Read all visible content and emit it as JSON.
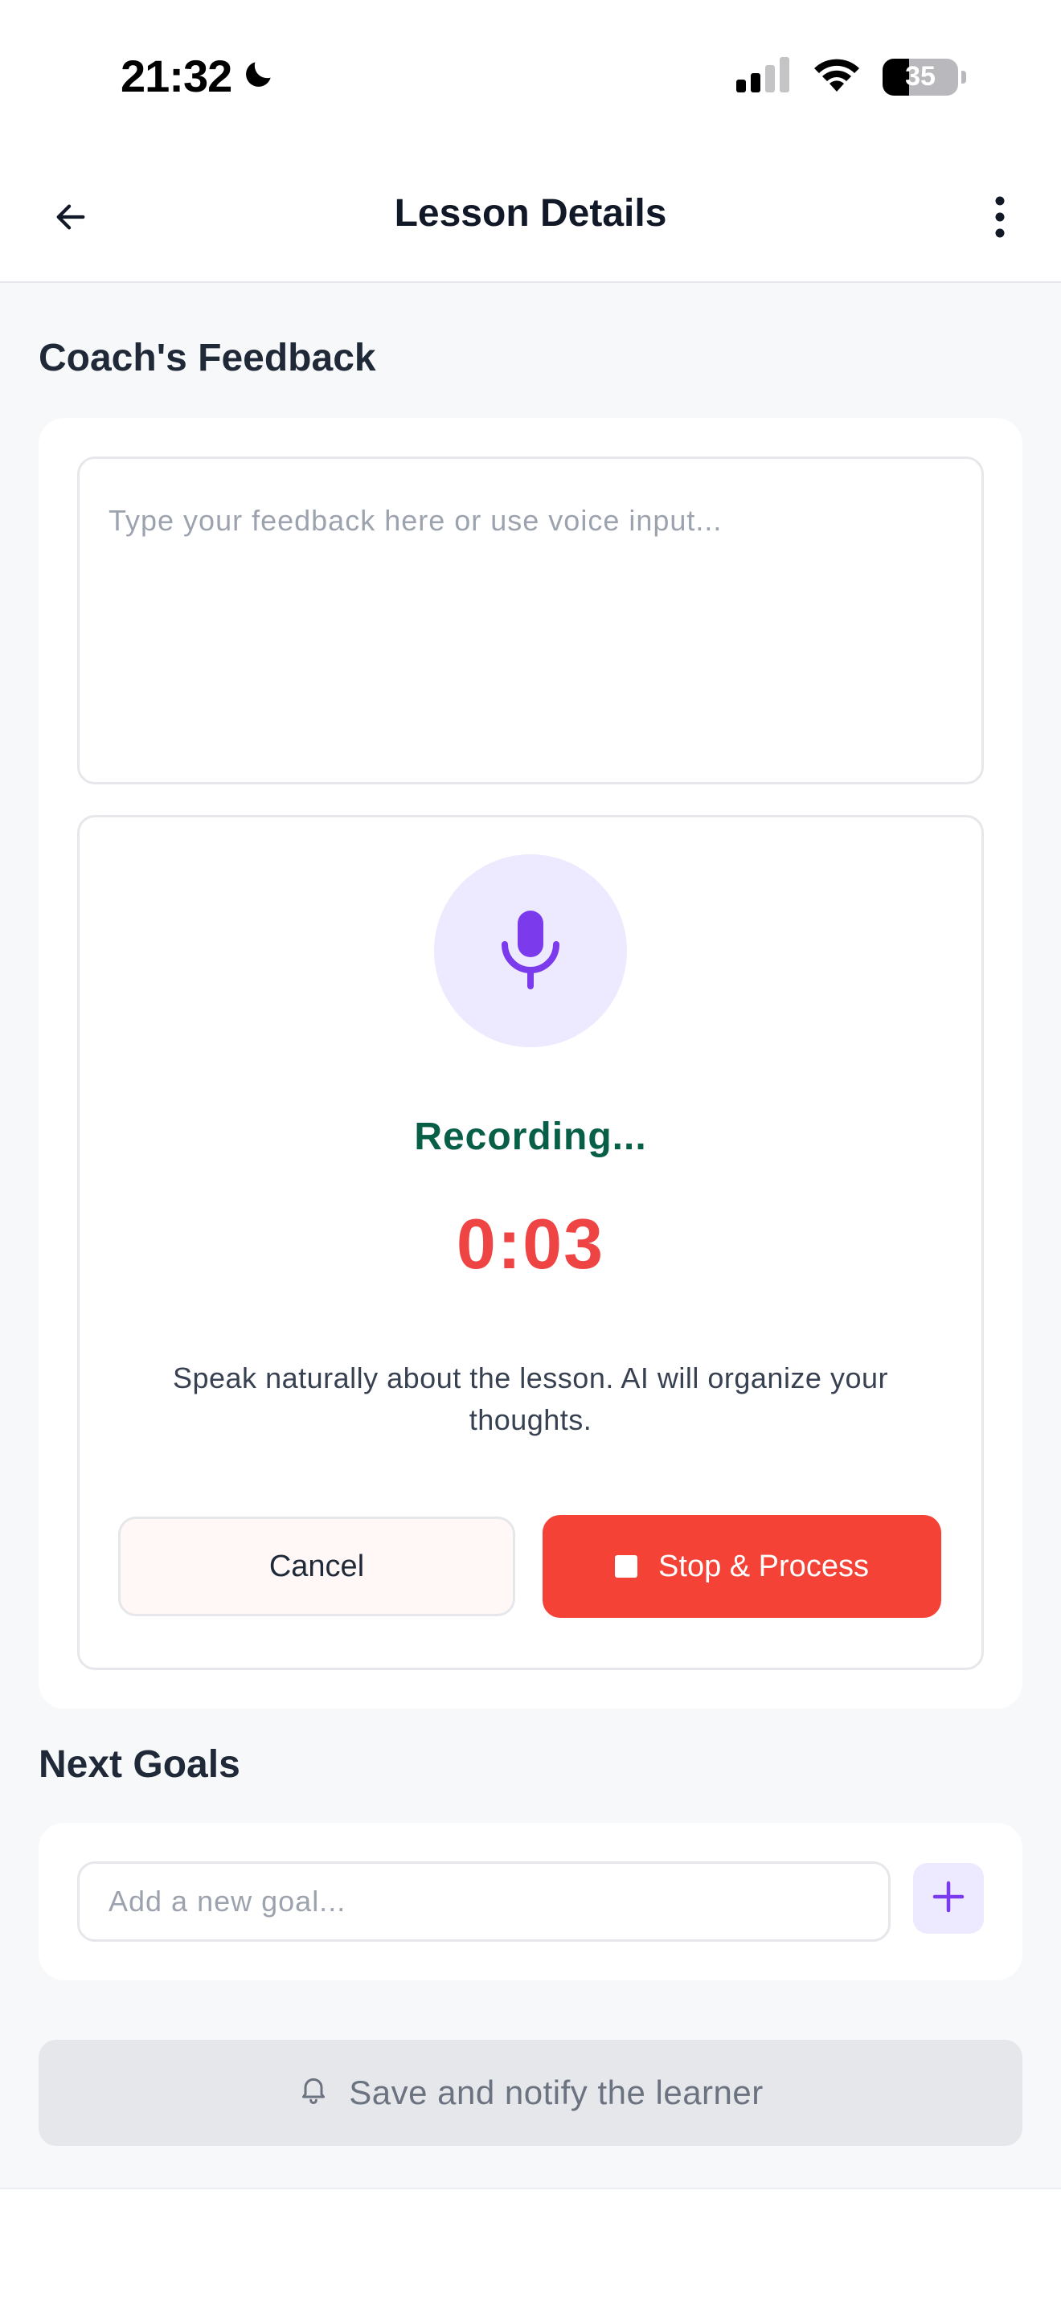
{
  "status_bar": {
    "time": "21:32",
    "battery_level": "35",
    "icons": [
      "moon-icon",
      "cellular-signal-icon",
      "wifi-icon",
      "battery-icon"
    ]
  },
  "header": {
    "title": "Lesson Details",
    "back_icon": "arrow-left-icon",
    "menu_icon": "more-vertical-icon"
  },
  "feedback": {
    "section_title": "Coach's Feedback",
    "placeholder": "Type your feedback here or use voice input...",
    "value": ""
  },
  "recorder": {
    "icon": "microphone-icon",
    "status": "Recording...",
    "timer": "0:03",
    "hint": "Speak naturally about the lesson. AI will organize your thoughts.",
    "cancel_label": "Cancel",
    "stop_label": "Stop & Process"
  },
  "goals": {
    "section_title": "Next Goals",
    "placeholder": "Add a new goal...",
    "value": "",
    "add_icon": "plus-icon"
  },
  "save": {
    "label": "Save and notify the learner",
    "icon": "bell-icon"
  },
  "colors": {
    "accent_purple": "#7c3aed",
    "purple_tint": "#ede9fe",
    "recording_green": "#065f46",
    "timer_red": "#ef4444",
    "stop_red": "#f44336",
    "background": "#f7f8fa"
  }
}
